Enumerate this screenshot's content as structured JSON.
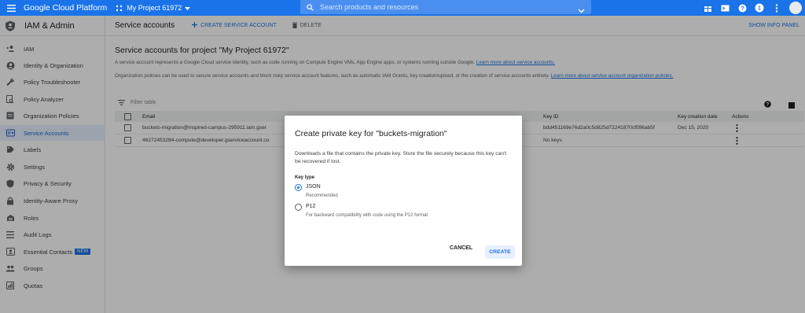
{
  "topbar": {
    "brand": "Google Cloud Platform",
    "project": "My Project 61972",
    "search_placeholder": "Search products and resources"
  },
  "sidebar": {
    "title": "IAM & Admin",
    "items": [
      {
        "label": "IAM",
        "icon": "person-add-icon"
      },
      {
        "label": "Identity & Organization",
        "icon": "person-circle-icon"
      },
      {
        "label": "Policy Troubleshooter",
        "icon": "wrench-icon"
      },
      {
        "label": "Policy Analyzer",
        "icon": "document-search-icon"
      },
      {
        "label": "Organization Policies",
        "icon": "list-box-icon"
      },
      {
        "label": "Service Accounts",
        "icon": "service-account-icon"
      },
      {
        "label": "Labels",
        "icon": "label-icon"
      },
      {
        "label": "Settings",
        "icon": "gear-icon"
      },
      {
        "label": "Privacy & Security",
        "icon": "shield-icon"
      },
      {
        "label": "Identity-Aware Proxy",
        "icon": "lock-icon"
      },
      {
        "label": "Roles",
        "icon": "roles-icon"
      },
      {
        "label": "Audit Logs",
        "icon": "lines-icon"
      },
      {
        "label": "Essential Contacts",
        "icon": "contacts-icon",
        "badge": "NEW"
      },
      {
        "label": "Groups",
        "icon": "group-icon"
      },
      {
        "label": "Quotas",
        "icon": "quota-icon"
      }
    ]
  },
  "actionbar": {
    "title": "Service accounts",
    "create": "CREATE SERVICE ACCOUNT",
    "delete": "DELETE",
    "info": "SHOW INFO PANEL"
  },
  "content": {
    "heading": "Service accounts for project \"My Project 61972\"",
    "desc1": "A service account represents a Google Cloud service identity, such as code running on Compute Engine VMs, App Engine apps, or systems running outside Google.",
    "link1": "Learn more about service accounts.",
    "desc2": "Organization policies can be used to secure service accounts and block risky service account features, such as automatic IAM Grants, key creation/upload, or the creation of service accounts entirely.",
    "link2": "Learn more about service account organization policies."
  },
  "filter": {
    "placeholder": "Filter table"
  },
  "table": {
    "headers": {
      "email": "Email",
      "key_id": "Key ID",
      "date": "Key creation date",
      "actions": "Actions"
    },
    "rows": [
      {
        "email": "buckets-migration@inspired-campus-295911.iam.gser",
        "key_id": "bdd451169e76d2a0c5d825d72241870cf596ab5f",
        "date": "Dec 15, 2020"
      },
      {
        "email": "46272453284-compute@developer.gserviceaccount.co",
        "key_id": "No keys",
        "date": ""
      }
    ]
  },
  "dialog": {
    "title": "Create private key for \"buckets-migration\"",
    "description": "Downloads a file that contains the private key. Store the file securely because this key can't be recovered if lost.",
    "key_type_label": "Key type",
    "options": [
      {
        "name": "JSON",
        "sub": "Recommended",
        "selected": true
      },
      {
        "name": "P12",
        "sub": "For backward compatibility with code using the P12 format",
        "selected": false
      }
    ],
    "cancel": "CANCEL",
    "create": "CREATE"
  },
  "colors": {
    "accent": "#1a73e8",
    "active_bg": "#e8f0fe",
    "overlay": "rgba(0,0,0,0.32)"
  }
}
